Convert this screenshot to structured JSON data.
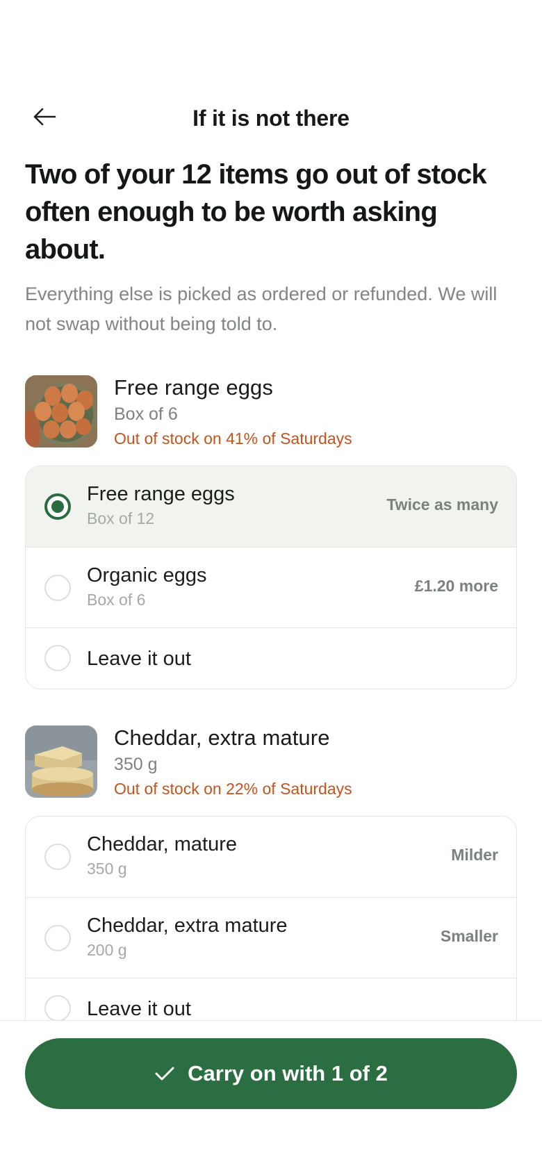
{
  "header": {
    "back_icon": "arrow-left-icon",
    "title": "If it is not there"
  },
  "intro": {
    "headline": "Two of your 12 items go out of stock often enough to be worth asking about.",
    "subtext": "Everything else is picked as ordered or refunded. We will not swap without being told to."
  },
  "items": [
    {
      "name": "Free range eggs",
      "size": "Box of 6",
      "warning": "Out of stock on 41% of Saturdays",
      "image": "eggs-photo",
      "options": [
        {
          "name": "Free range eggs",
          "size": "Box of 12",
          "note": "Twice as many",
          "selected": true
        },
        {
          "name": "Organic eggs",
          "size": "Box of 6",
          "note": "£1.20 more",
          "selected": false
        },
        {
          "name": "Leave it out",
          "size": "",
          "note": "",
          "selected": false
        }
      ]
    },
    {
      "name": "Cheddar, extra mature",
      "size": "350 g",
      "warning": "Out of stock on 22% of Saturdays",
      "image": "cheese-photo",
      "options": [
        {
          "name": "Cheddar, mature",
          "size": "350 g",
          "note": "Milder",
          "selected": false
        },
        {
          "name": "Cheddar, extra mature",
          "size": "200 g",
          "note": "Smaller",
          "selected": false
        },
        {
          "name": "Leave it out",
          "size": "",
          "note": "",
          "selected": false
        }
      ]
    }
  ],
  "footer": {
    "cta_icon": "check-icon",
    "cta_label": "Carry on with 1 of 2"
  },
  "colors": {
    "accent": "#2b6e42",
    "warning": "#c4541b",
    "selected_bg": "#f1f3ef"
  }
}
